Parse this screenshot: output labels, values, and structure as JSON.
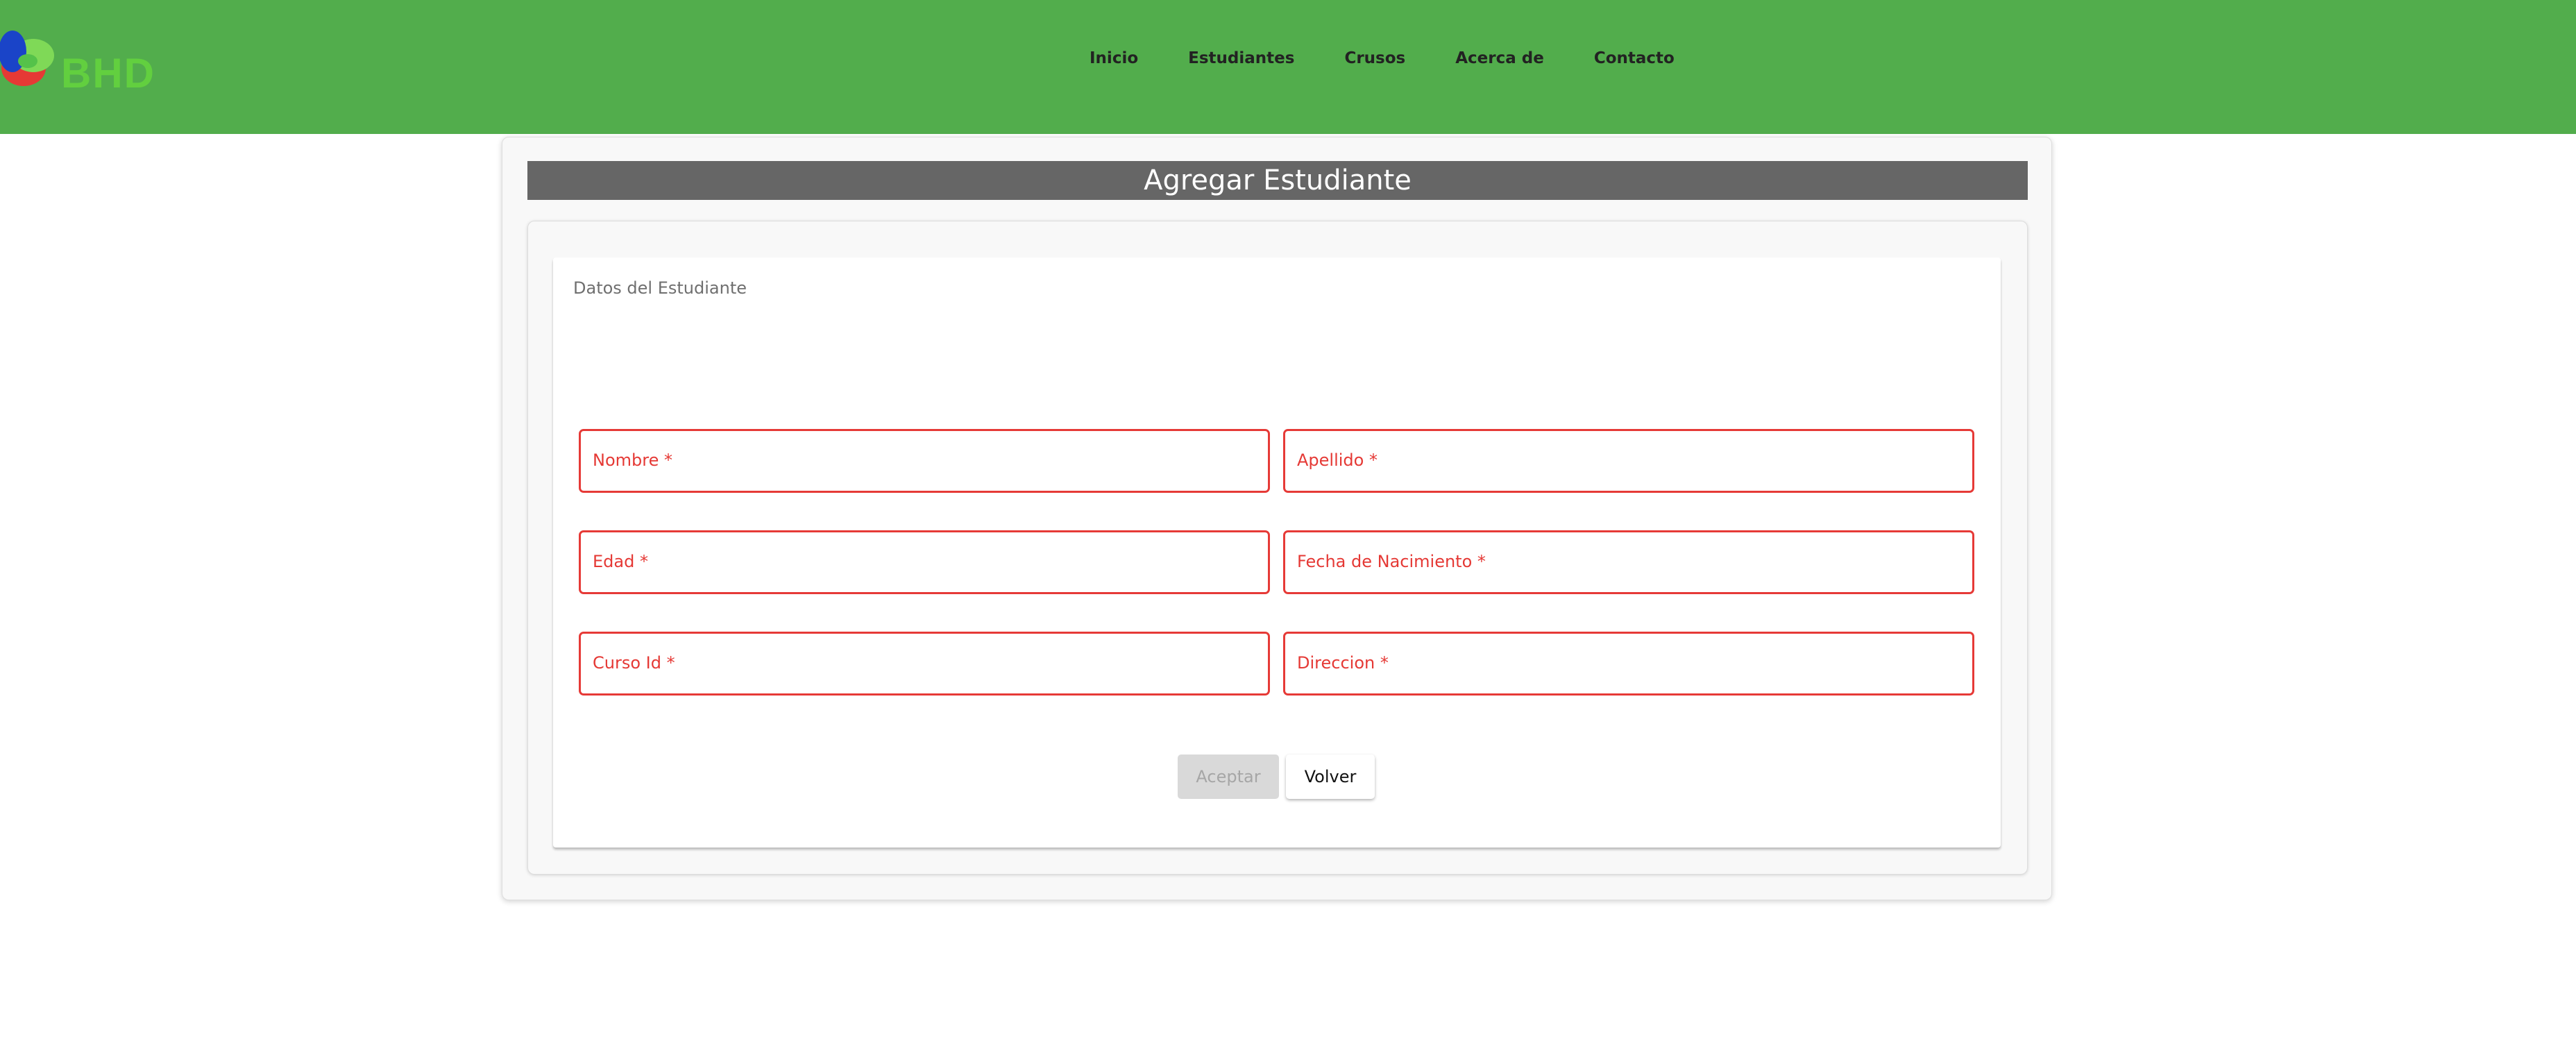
{
  "brand": {
    "name": "BHD"
  },
  "nav": {
    "items": [
      {
        "label": "Inicio"
      },
      {
        "label": "Estudiantes"
      },
      {
        "label": "Crusos"
      },
      {
        "label": "Acerca de"
      },
      {
        "label": "Contacto"
      }
    ]
  },
  "page": {
    "title": "Agregar Estudiante"
  },
  "form": {
    "section_title": "Datos del Estudiante",
    "fields": [
      {
        "label": "Nombre *",
        "value": ""
      },
      {
        "label": "Apellido *",
        "value": ""
      },
      {
        "label": "Edad *",
        "value": ""
      },
      {
        "label": "Fecha de Nacimiento *",
        "value": ""
      },
      {
        "label": "Curso Id *",
        "value": ""
      },
      {
        "label": "Direccion *",
        "value": ""
      }
    ],
    "accept_label": "Aceptar",
    "back_label": "Volver"
  },
  "colors": {
    "navbar": "#52ad4c",
    "title_bar": "#666666",
    "error": "#e53935"
  }
}
